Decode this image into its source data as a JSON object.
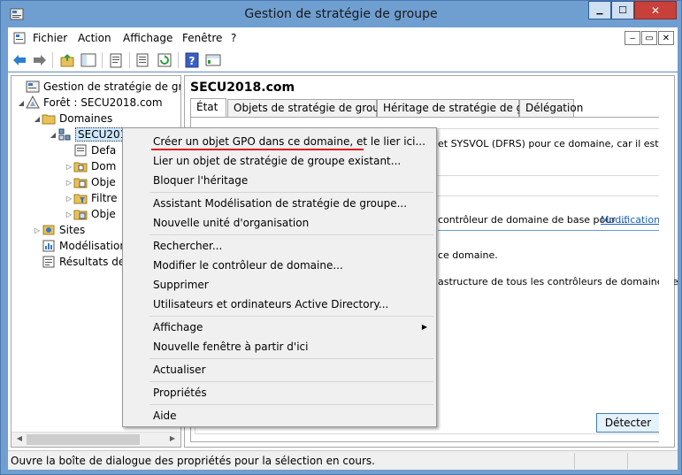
{
  "window": {
    "title": "Gestion de stratégie de groupe",
    "controls": {
      "minimize": "▁",
      "maximize": "☐",
      "close": "✕"
    }
  },
  "menubar": {
    "items": [
      "Fichier",
      "Action",
      "Affichage",
      "Fenêtre",
      "?"
    ],
    "mdi_controls": {
      "minimize": "‒",
      "restore": "▭",
      "close": "✕"
    }
  },
  "toolbar": {
    "icons": [
      "back-icon",
      "forward-icon",
      "up-folder-icon",
      "show-hide-tree-icon",
      "properties-icon",
      "export-list-icon",
      "refresh-icon",
      "help-icon",
      "console-view-icon"
    ]
  },
  "tree": {
    "items": [
      {
        "label": "Gestion de stratégie de groupe",
        "icon": "gpm-icon"
      },
      {
        "label": "Forêt : SECU2018.com",
        "icon": "forest-icon"
      },
      {
        "label": "Domaines",
        "icon": "domains-folder-icon"
      },
      {
        "label": "SECU2018.com",
        "icon": "domain-icon"
      },
      {
        "label": "Default Domain Policy",
        "icon": "gpo-link-icon"
      },
      {
        "label": "Domain Controllers",
        "icon": "ou-icon"
      },
      {
        "label": "Objets de stratégie de groupe",
        "icon": "gpo-folder-icon"
      },
      {
        "label": "Filtres WMI",
        "icon": "wmi-folder-icon"
      },
      {
        "label": "Objets GPO Starter",
        "icon": "starter-gpo-icon"
      },
      {
        "label": "Sites",
        "icon": "sites-icon"
      },
      {
        "label": "Modélisation de stratégie de groupe",
        "icon": "modeling-icon"
      },
      {
        "label": "Résultats de stratégie de groupe",
        "icon": "results-icon"
      }
    ],
    "visible_labels": [
      "Gestion de stratégie de groupe",
      "Forêt : SECU2018.com",
      "Domaines",
      "SECU2018",
      "Defa",
      "Dom",
      "Obje",
      "Filtre",
      "Obje",
      "Sites",
      "Modélisation",
      "Résultats de"
    ]
  },
  "right_pane": {
    "title": "SECU2018.com",
    "tabs": [
      "État",
      "Objets de stratégie de groupe liés",
      "Héritage de stratégie de groupe",
      "Délégation"
    ],
    "active_tab": "État",
    "text_1": "et SYSVOL (DFRS) pour ce domaine, car il est",
    "text_2": "contrôleur de domaine de base pour ...",
    "link": "Modification",
    "text_3": "ce domaine.",
    "text_4": "astructure de tous les contrôleurs de domaine de",
    "detect_button": "Détecter"
  },
  "context_menu": {
    "items": [
      "Créer un objet GPO dans ce domaine, et le lier ici...",
      "Lier un objet de stratégie de groupe existant...",
      "Bloquer l'héritage",
      "Assistant Modélisation de stratégie de groupe...",
      "Nouvelle unité d'organisation",
      "Rechercher...",
      "Modifier le contrôleur de domaine...",
      "Supprimer",
      "Utilisateurs et ordinateurs Active Directory...",
      "Affichage",
      "Nouvelle fenêtre à partir d'ici",
      "Actualiser",
      "Propriétés",
      "Aide"
    ],
    "highlight_color": "#e3141a"
  },
  "statusbar": {
    "text": "Ouvre la boîte de dialogue des propriétés pour la sélection en cours."
  }
}
